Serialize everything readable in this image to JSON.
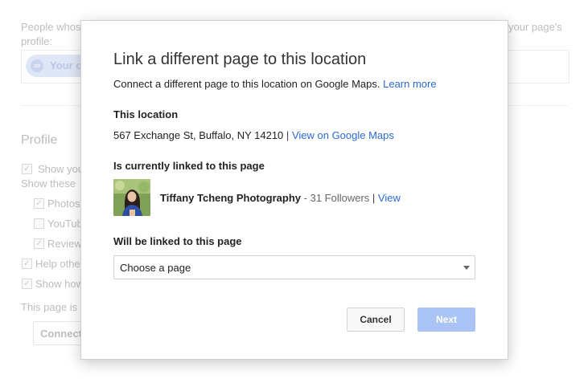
{
  "background": {
    "intro_left": "People whos",
    "intro_right": "your page's",
    "intro_line2": "profile:",
    "chip_label": "Your c",
    "profile_heading": "Profile",
    "show_you": "Show you",
    "show_these": "Show these",
    "photos": "Photos",
    "youtube": "YouTub",
    "reviews": "Review",
    "help_other": "Help othe",
    "show_how": "Show how",
    "page_is": "This page is",
    "connect_btn": "Connect"
  },
  "modal": {
    "title": "Link a different page to this location",
    "description": "Connect a different page to this location on Google Maps.",
    "learn_more": "Learn more",
    "this_location_heading": "This location",
    "address": "567 Exchange St, Buffalo, NY 14210",
    "separator": "|",
    "view_on_maps": "View on Google Maps",
    "current_heading": "Is currently linked to this page",
    "current_page_name": "Tiffany Tcheng Photography",
    "current_page_followers": " - 31 Followers",
    "current_page_view": "View",
    "new_heading": "Will be linked to this page",
    "select_value": "Choose a page",
    "cancel_label": "Cancel",
    "next_label": "Next"
  },
  "colors": {
    "link": "#2a6ad6",
    "next_disabled": "#a9c4f5"
  }
}
